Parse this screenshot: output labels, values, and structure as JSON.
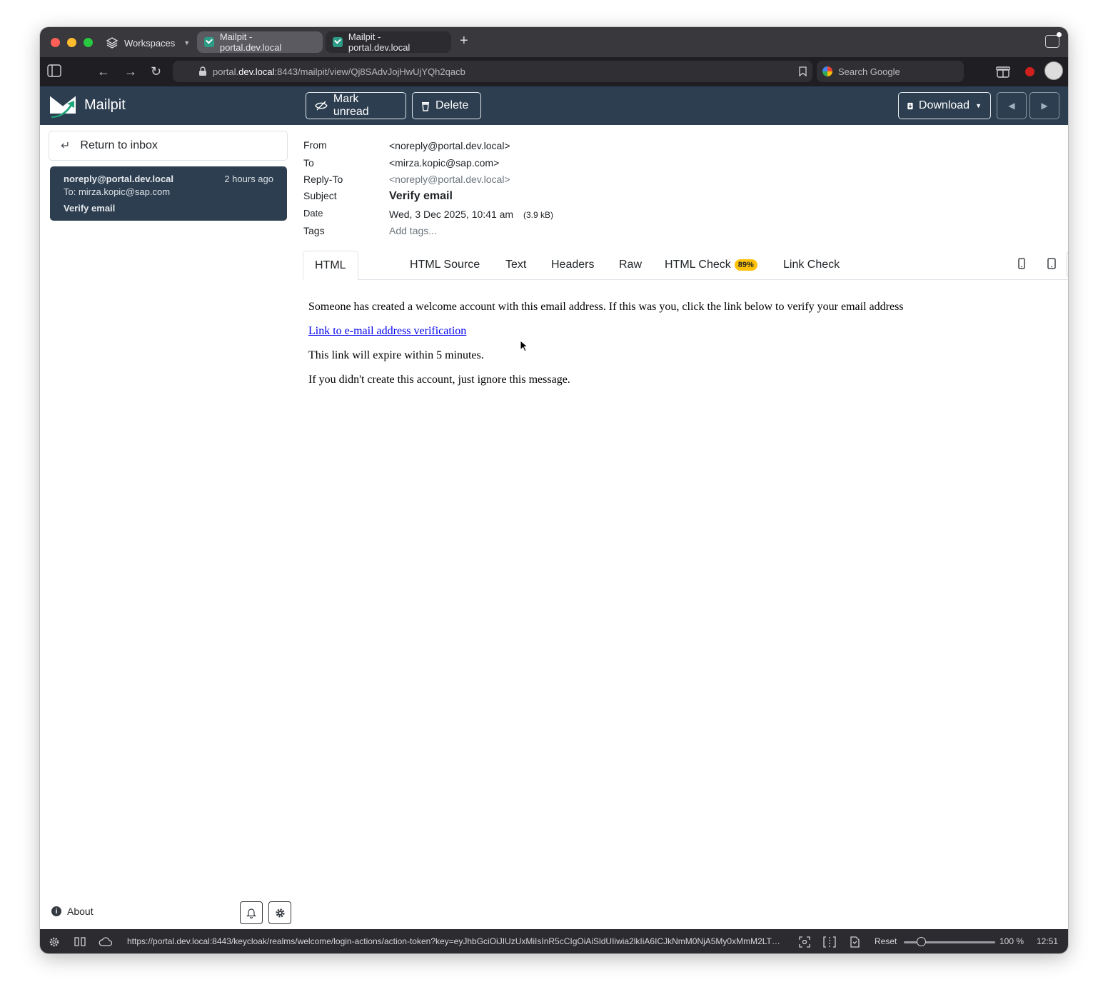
{
  "browser": {
    "workspaces_label": "Workspaces",
    "tabs": [
      {
        "title": "Mailpit - portal.dev.local",
        "active": true
      },
      {
        "title": "Mailpit - portal.dev.local",
        "active": false
      }
    ],
    "url": {
      "prefix": "portal.",
      "host": "dev.local",
      "rest": ":8443/mailpit/view/Qj8SAdvJojHwUjYQh2qacb"
    },
    "search_placeholder": "Search Google"
  },
  "app": {
    "name": "Mailpit",
    "toolbar": {
      "mark_unread": "Mark unread",
      "delete": "Delete",
      "download": "Download"
    }
  },
  "sidebar": {
    "return_label": "Return to inbox",
    "message": {
      "from": "noreply@portal.dev.local",
      "time": "2 hours ago",
      "to": "To: mirza.kopic@sap.com",
      "subject": "Verify email"
    },
    "about_label": "About"
  },
  "headers": {
    "from_label": "From",
    "from_value": "<noreply@portal.dev.local>",
    "to_label": "To",
    "to_value": "<mirza.kopic@sap.com>",
    "replyto_label": "Reply-To",
    "replyto_value": "<noreply@portal.dev.local>",
    "subject_label": "Subject",
    "subject_value": "Verify email",
    "date_label": "Date",
    "date_value": "Wed, 3 Dec 2025, 10:41 am",
    "size_value": "(3.9 kB)",
    "tags_label": "Tags",
    "tags_placeholder": "Add tags..."
  },
  "view_tabs": {
    "html": "HTML",
    "html_source": "HTML Source",
    "text": "Text",
    "headers": "Headers",
    "raw": "Raw",
    "html_check": "HTML Check",
    "html_check_badge": "89%",
    "link_check": "Link Check"
  },
  "email_body": {
    "line1": "Someone has created a welcome account with this email address. If this was you, click the link below to verify your email address",
    "link": "Link to e-mail address verification",
    "line2": "This link will expire within 5 minutes.",
    "line3": "If you didn't create this account, just ignore this message."
  },
  "statusbar": {
    "hover_url": "https://portal.dev.local:8443/keycloak/realms/welcome/login-actions/action-token?key=eyJhbGciOiJIUzUxMiIsInR5cCIgOiAiSldUIiwia2lkIiA6ICJkNmM0NjA5My0xMmM2LTQ...",
    "reset_label": "Reset",
    "zoom": "100 %",
    "zoom_fraction": 0.15,
    "clock": "12:51"
  },
  "colors": {
    "app_header": "#2c3e50",
    "badge": "#ffc107",
    "link": "#0000ee"
  }
}
